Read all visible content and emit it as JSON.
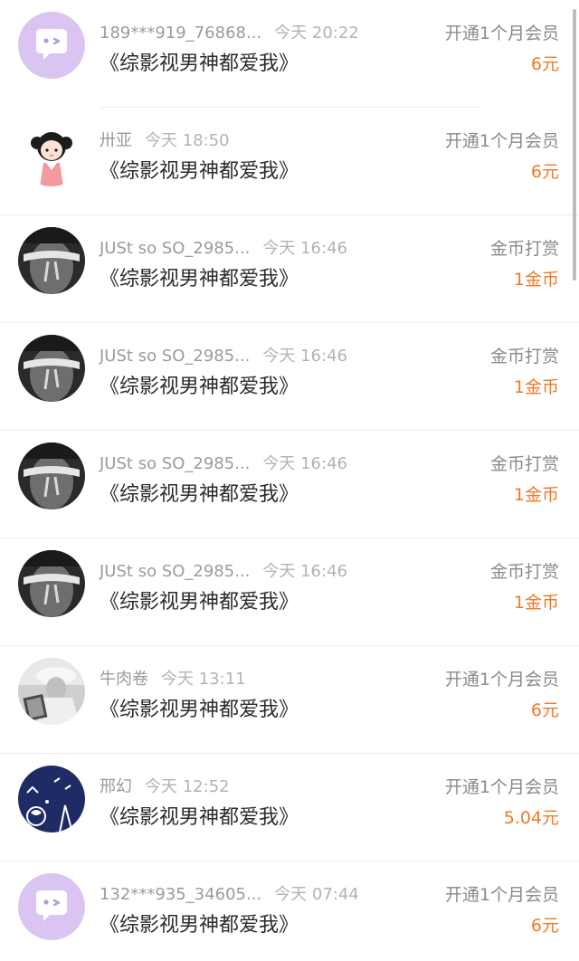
{
  "records": [
    {
      "user": "189***919_76868...",
      "time": "今天 20:22",
      "book": "《综影视男神都爱我》",
      "action": "开通1个月会员",
      "amount": "6元",
      "avatar_icon": "chat-bubble-avatar-icon"
    },
    {
      "user": "卅亚",
      "time": "今天 18:50",
      "book": "《综影视男神都爱我》",
      "action": "开通1个月会员",
      "amount": "6元",
      "avatar_icon": "cartoon-girl-avatar"
    },
    {
      "user": "JUSt so SO_2985...",
      "time": "今天 16:46",
      "book": "《综影视男神都爱我》",
      "action": "金币打赏",
      "amount": "1金币",
      "avatar_icon": "blindfold-portrait-avatar"
    },
    {
      "user": "JUSt so SO_2985...",
      "time": "今天 16:46",
      "book": "《综影视男神都爱我》",
      "action": "金币打赏",
      "amount": "1金币",
      "avatar_icon": "blindfold-portrait-avatar"
    },
    {
      "user": "JUSt so SO_2985...",
      "time": "今天 16:46",
      "book": "《综影视男神都爱我》",
      "action": "金币打赏",
      "amount": "1金币",
      "avatar_icon": "blindfold-portrait-avatar"
    },
    {
      "user": "JUSt so SO_2985...",
      "time": "今天 16:46",
      "book": "《综影视男神都爱我》",
      "action": "金币打赏",
      "amount": "1金币",
      "avatar_icon": "blindfold-portrait-avatar"
    },
    {
      "user": "牛肉卷",
      "time": "今天 13:11",
      "book": "《综影视男神都爱我》",
      "action": "开通1个月会员",
      "amount": "6元",
      "avatar_icon": "person-in-hat-avatar"
    },
    {
      "user": "邢幻",
      "time": "今天 12:52",
      "book": "《综影视男神都爱我》",
      "action": "开通1个月会员",
      "amount": "5.04元",
      "avatar_icon": "navy-illustration-avatar"
    },
    {
      "user": "132***935_34605...",
      "time": "今天 07:44",
      "book": "《综影视男神都爱我》",
      "action": "开通1个月会员",
      "amount": "6元",
      "avatar_icon": "chat-bubble-avatar-icon"
    }
  ],
  "colors": {
    "amount": "#ef7a25",
    "username": "#9b9b9b",
    "title": "#2c2c2c",
    "action": "#8a8a8a",
    "default_avatar_bg": "#d9c4f2",
    "navy_avatar_bg": "#1f2b64"
  }
}
